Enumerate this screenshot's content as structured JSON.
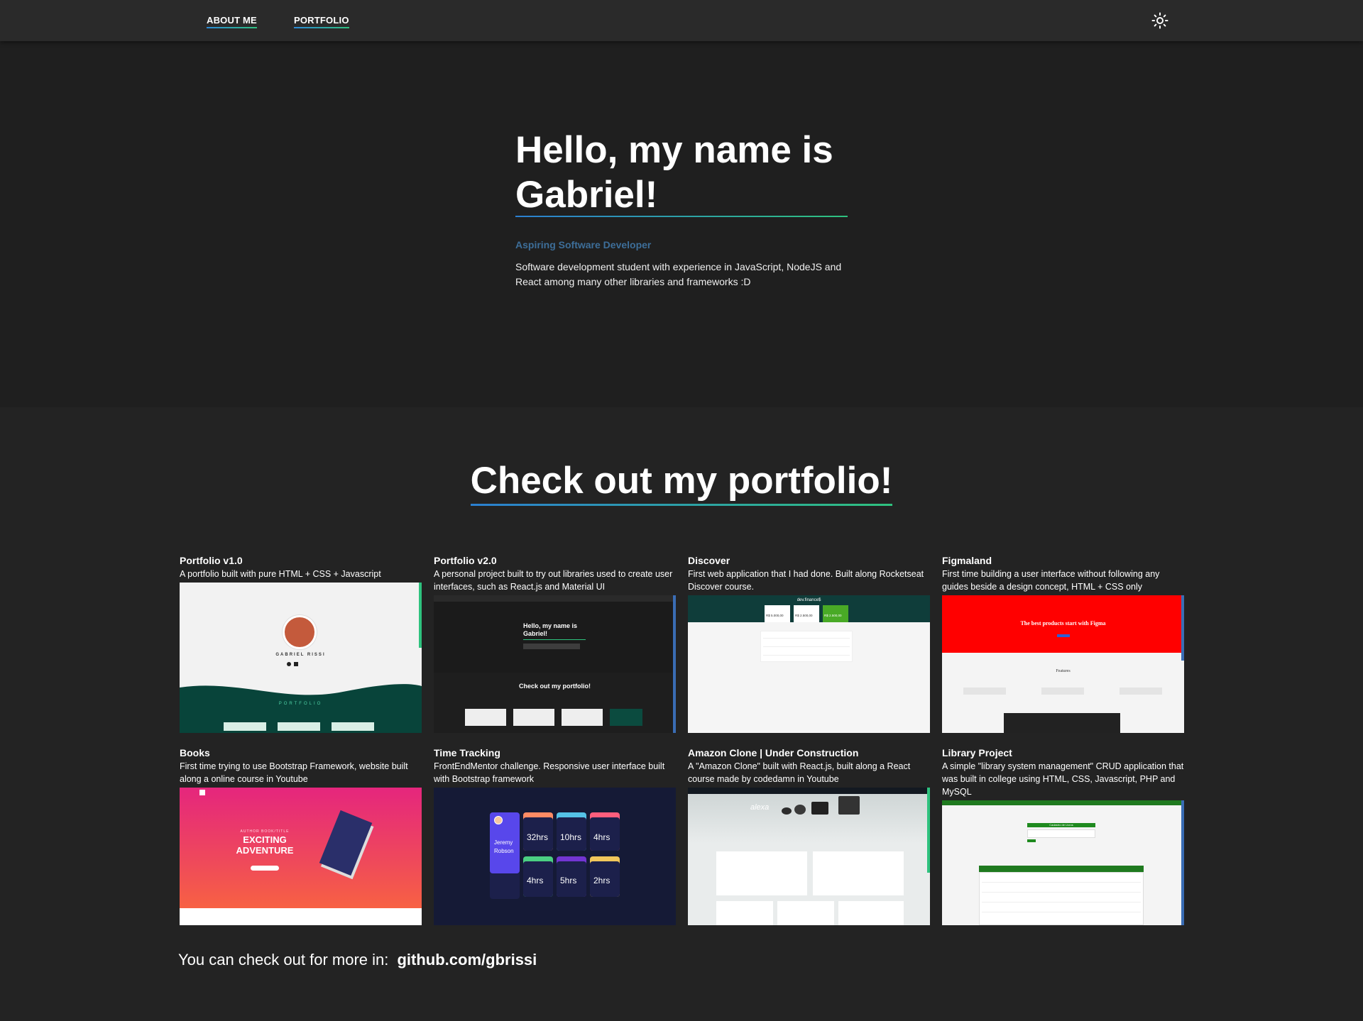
{
  "nav": {
    "about_label": "ABOUT ME",
    "portfolio_label": "PORTFOLIO",
    "theme_icon": "sun-icon"
  },
  "hero": {
    "title": "Hello, my name is Gabriel!",
    "subtitle": "Aspiring Software Developer",
    "description": "Software development student with experience in JavaScript, NodeJS and React among many other libraries and frameworks :D"
  },
  "portfolio": {
    "title": "Check out my portfolio!",
    "projects": [
      {
        "name": "Portfolio v1.0",
        "description": "A portfolio built with pure HTML + CSS + Javascript"
      },
      {
        "name": "Portfolio v2.0",
        "description": "A personal project built to try out libraries used to create user interfaces, such as React.js and Material UI"
      },
      {
        "name": "Discover",
        "description": "First web application that I had done. Built along Rocketseat Discover course."
      },
      {
        "name": "Figmaland",
        "description": "First time building a user interface without following any guides beside a design concept, HTML + CSS only"
      },
      {
        "name": "Books",
        "description": "First time trying to use Bootstrap Framework, website built along a online course in Youtube"
      },
      {
        "name": "Time Tracking",
        "description": "FrontEndMentor challenge. Responsive user interface built with Bootstrap framework"
      },
      {
        "name": "Amazon Clone | Under Construction",
        "description": "A \"Amazon Clone\" built with React.js, built along a React course made by codedamn in Youtube"
      },
      {
        "name": "Library Project",
        "description": "A simple \"library system management\" CRUD application that was built in college using HTML, CSS, Javascript, PHP and MySQL"
      }
    ],
    "thumbs": {
      "p1_name": "GABRIEL RISSI",
      "p1_section": "PORTFOLIO",
      "p2_hello": "Hello, my name is Gabriel!",
      "p2_check": "Check out my portfolio!",
      "p3_logo": "dev.finance$",
      "p3_v1": "R$ 5.000,00",
      "p3_v2": "R$ 2.500,00",
      "p3_v3": "R$ 2.500,00",
      "p4_headline": "The best products start with Figma",
      "p4_features": "Features",
      "p5_small": "AUTHOR BOOK/TITLE",
      "p5_big": "EXCITING ADVENTURE",
      "p6_user": "Jeremy Robson",
      "p6_hours": [
        "32hrs",
        "10hrs",
        "4hrs",
        "4hrs",
        "5hrs",
        "2hrs"
      ],
      "p7_brand": "alexa",
      "p8_title": "Cadastro de Livros"
    }
  },
  "footer": {
    "prefix": "You can check out for more in:",
    "link": "github.com/gbrissi"
  },
  "colors": {
    "accent_blue": "#2b7fd1",
    "accent_green": "#2ec27e",
    "subtitle": "#3d6e99",
    "background": "#232323"
  }
}
